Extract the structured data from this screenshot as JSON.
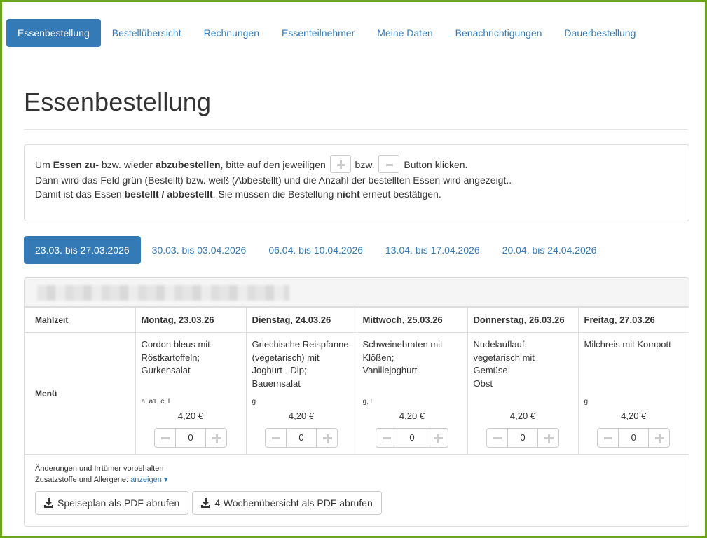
{
  "nav": [
    {
      "label": "Essenbestellung",
      "active": true
    },
    {
      "label": "Bestellübersicht",
      "active": false
    },
    {
      "label": "Rechnungen",
      "active": false
    },
    {
      "label": "Essenteilnehmer",
      "active": false
    },
    {
      "label": "Meine Daten",
      "active": false
    },
    {
      "label": "Benachrichtigungen",
      "active": false
    },
    {
      "label": "Dauerbestellung",
      "active": false
    }
  ],
  "page_title": "Essenbestellung",
  "info": {
    "line1": {
      "a": "Um ",
      "b": "Essen zu-",
      "c": " bzw. wieder ",
      "d": "abzubestellen",
      "e": ", bitte auf den jeweiligen ",
      "f": " bzw. ",
      "g": " Button klicken."
    },
    "line2": "Dann wird das Feld grün (Bestellt) bzw. weiß (Abbestellt) und die Anzahl der bestellten Essen wird angezeigt..",
    "line3": {
      "a": "Damit ist das Essen ",
      "b": "bestellt / abbestellt",
      "c": ". Sie müssen die Bestellung ",
      "d": "nicht",
      "e": " erneut bestätigen."
    }
  },
  "weeks": [
    {
      "label": "23.03. bis 27.03.2026",
      "active": true
    },
    {
      "label": "30.03. bis 03.04.2026",
      "active": false
    },
    {
      "label": "06.04. bis 10.04.2026",
      "active": false
    },
    {
      "label": "13.04. bis 17.04.2026",
      "active": false
    },
    {
      "label": "20.04. bis 24.04.2026",
      "active": false
    }
  ],
  "table": {
    "col_label": "Mahlzeit",
    "row_label": "Menü",
    "days": [
      {
        "header": "Montag, 23.03.26",
        "menu": "Cordon bleus mit\nRöstkartoffeln;\nGurkensalat",
        "allergens": "a, a1, c, l",
        "price": "4,20 €",
        "qty": "0"
      },
      {
        "header": "Dienstag, 24.03.26",
        "menu": "Griechische Reispfanne\n(vegetarisch) mit\nJoghurt - Dip;\nBauernsalat",
        "allergens": "g",
        "price": "4,20 €",
        "qty": "0"
      },
      {
        "header": "Mittwoch, 25.03.26",
        "menu": "Schweinebraten mit\nKlößen;\nVanillejoghurt",
        "allergens": "g, l",
        "price": "4,20 €",
        "qty": "0"
      },
      {
        "header": "Donnerstag, 26.03.26",
        "menu": "Nudelauflauf,\nvegetarisch mit\nGemüse;\nObst",
        "allergens": "",
        "price": "4,20 €",
        "qty": "0"
      },
      {
        "header": "Freitag, 27.03.26",
        "menu": "Milchreis mit Kompott",
        "allergens": "g",
        "price": "4,20 €",
        "qty": "0"
      }
    ]
  },
  "footer": {
    "disclaimer": "Änderungen und Irrtümer vorbehalten",
    "allergen_label": "Zusatzstoffe und Allergene: ",
    "allergen_link": "anzeigen ▾",
    "btn_pdf": "Speiseplan als PDF abrufen",
    "btn_pdf4": "4-Wochenübersicht als PDF abrufen"
  },
  "colors": {
    "primary": "#337ab7",
    "frame": "#6aa51e"
  }
}
